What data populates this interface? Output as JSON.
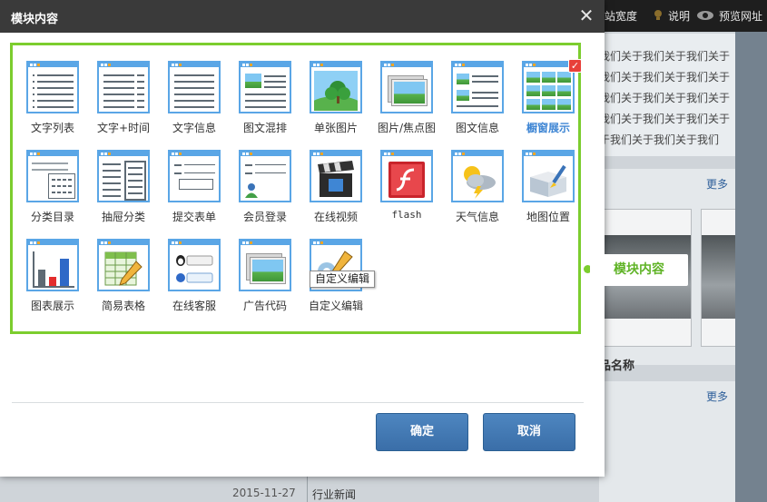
{
  "background": {
    "topbar": {
      "links": [
        "站宽度",
        "说明",
        "预览网址"
      ]
    },
    "text_lines": [
      "我们关于我们关于我们关于",
      "我们关于我们关于我们关于",
      "我们关于我们关于我们关于",
      "我们关于我们关于我们关于",
      "我们关于我们关于我们关于",
      "于我们关于我们关于我们"
    ],
    "more_label": "更多",
    "product_name": "品名称",
    "news": {
      "date": "2015-11-27",
      "title": "行业新闻"
    }
  },
  "modal": {
    "title": "模块内容",
    "close_label": "✕",
    "items": [
      {
        "label": "文字列表",
        "icon": "text-list-icon"
      },
      {
        "label": "文字+时间",
        "icon": "text-time-icon"
      },
      {
        "label": "文字信息",
        "icon": "text-info-icon"
      },
      {
        "label": "图文混排",
        "icon": "mixed-layout-icon"
      },
      {
        "label": "单张图片",
        "icon": "single-image-icon"
      },
      {
        "label": "图片/焦点图",
        "icon": "slideshow-icon"
      },
      {
        "label": "图文信息",
        "icon": "image-text-icon"
      },
      {
        "label": "橱窗展示",
        "icon": "showcase-icon",
        "selected": true
      },
      {
        "label": "分类目录",
        "icon": "category-icon"
      },
      {
        "label": "抽屉分类",
        "icon": "drawer-icon"
      },
      {
        "label": "提交表单",
        "icon": "form-icon"
      },
      {
        "label": "会员登录",
        "icon": "member-login-icon"
      },
      {
        "label": "在线视频",
        "icon": "video-icon"
      },
      {
        "label": "flash",
        "icon": "flash-icon"
      },
      {
        "label": "天气信息",
        "icon": "weather-icon"
      },
      {
        "label": "地图位置",
        "icon": "map-icon"
      },
      {
        "label": "图表展示",
        "icon": "chart-icon"
      },
      {
        "label": "简易表格",
        "icon": "table-icon"
      },
      {
        "label": "在线客服",
        "icon": "customer-service-icon"
      },
      {
        "label": "广告代码",
        "icon": "ad-code-icon"
      },
      {
        "label": "自定义编辑",
        "icon": "custom-edit-icon"
      }
    ],
    "tooltip": "自定义编辑",
    "callout": "模块内容",
    "confirm_label": "确定",
    "cancel_label": "取消",
    "check_mark": "✓"
  }
}
